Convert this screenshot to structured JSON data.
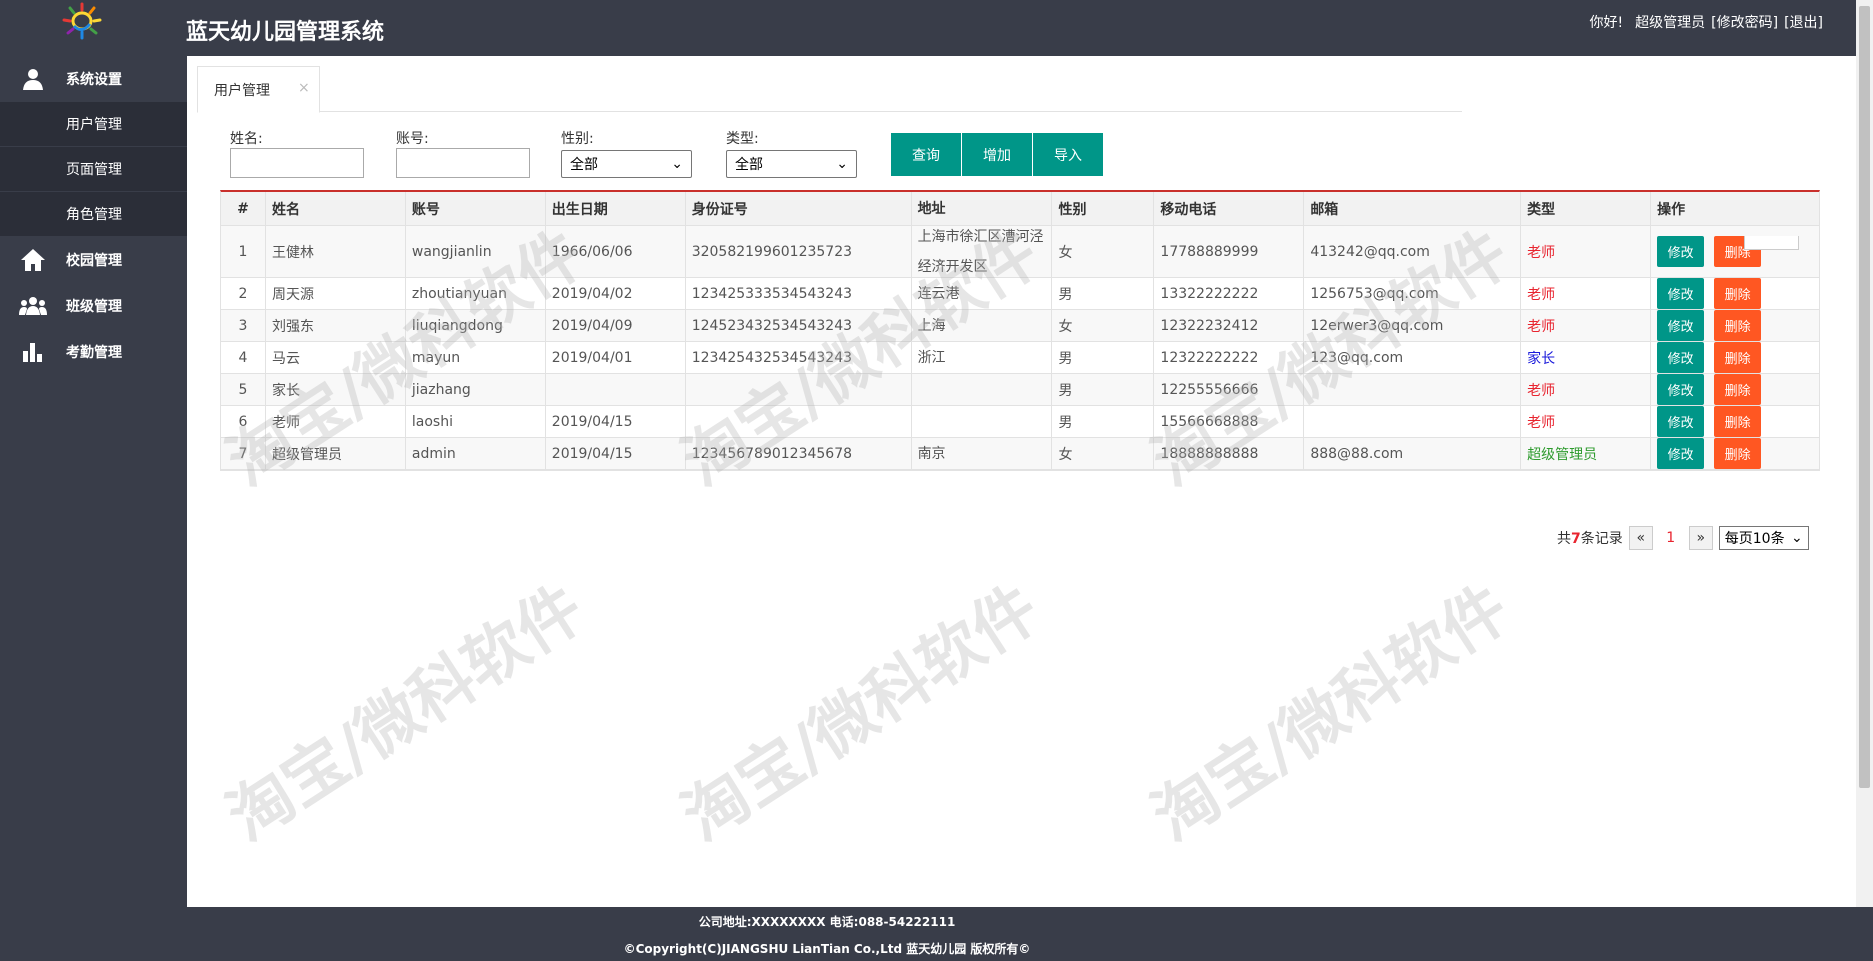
{
  "header": {
    "title": "蓝天幼儿园管理系统",
    "greeting": "你好!",
    "user_name": "超级管理员",
    "change_password": "[修改密码]",
    "logout": "[退出]"
  },
  "sidebar": {
    "groups": [
      {
        "label": "系统设置",
        "icon": "user-icon"
      },
      {
        "label": "校园管理",
        "icon": "home-icon"
      },
      {
        "label": "班级管理",
        "icon": "users-icon"
      },
      {
        "label": "考勤管理",
        "icon": "bar-chart-icon"
      }
    ],
    "sub_items": [
      "用户管理",
      "页面管理",
      "角色管理"
    ]
  },
  "tab": {
    "label": "用户管理",
    "close": "×"
  },
  "search": {
    "name_label": "姓名:",
    "account_label": "账号:",
    "gender_label": "性别:",
    "gender_value": "全部",
    "type_label": "类型:",
    "type_value": "全部",
    "buttons": {
      "query": "查询",
      "add": "增加",
      "import": "导入"
    }
  },
  "table": {
    "columns": [
      "#",
      "姓名",
      "账号",
      "出生日期",
      "身份证号",
      "地址",
      "性别",
      "移动电话",
      "邮箱",
      "类型",
      "操作"
    ],
    "edit_label": "修改",
    "delete_label": "删除",
    "rows": [
      {
        "no": "1",
        "name": "王健林",
        "account": "wangjianlin",
        "birth": "1966/06/06",
        "id": "320582199601235723",
        "addr": "上海市徐汇区漕河泾经济开发区",
        "gender": "女",
        "phone": "17788889999",
        "email": "413242@qq.com",
        "type": "老师",
        "type_class": "teacher"
      },
      {
        "no": "2",
        "name": "周天源",
        "account": "zhoutianyuan",
        "birth": "2019/04/02",
        "id": "123425333534543243",
        "addr": "连云港",
        "gender": "男",
        "phone": "13322222222",
        "email": "1256753@qq.com",
        "type": "老师",
        "type_class": "teacher"
      },
      {
        "no": "3",
        "name": "刘强东",
        "account": "liuqiangdong",
        "birth": "2019/04/09",
        "id": "124523432534543243",
        "addr": "上海",
        "gender": "女",
        "phone": "12322232412",
        "email": "12erwer3@qq.com",
        "type": "老师",
        "type_class": "teacher"
      },
      {
        "no": "4",
        "name": "马云",
        "account": "mayun",
        "birth": "2019/04/01",
        "id": "123425432534543243",
        "addr": "浙江",
        "gender": "男",
        "phone": "12322222222",
        "email": "123@qq.com",
        "type": "家长",
        "type_class": "parent"
      },
      {
        "no": "5",
        "name": "家长",
        "account": "jiazhang",
        "birth": "",
        "id": "",
        "addr": "",
        "gender": "男",
        "phone": "12255556666",
        "email": "",
        "type": "老师",
        "type_class": "teacher"
      },
      {
        "no": "6",
        "name": "老师",
        "account": "laoshi",
        "birth": "2019/04/15",
        "id": "",
        "addr": "",
        "gender": "男",
        "phone": "15566668888",
        "email": "",
        "type": "老师",
        "type_class": "teacher"
      },
      {
        "no": "7",
        "name": "超级管理员",
        "account": "admin",
        "birth": "2019/04/15",
        "id": "123456789012345678",
        "addr": "南京",
        "gender": "女",
        "phone": "18888888888",
        "email": "888@88.com",
        "type": "超级管理员",
        "type_class": "admin"
      }
    ]
  },
  "pager": {
    "total_prefix": "共",
    "total": "7",
    "total_suffix": "条记录",
    "prev": "«",
    "current": "1",
    "next": "»",
    "page_size": "每页10条"
  },
  "footer": {
    "line1": "公司地址:XXXXXXXX 电话:088-54222111",
    "line2": "©Copyright(C)JIANGSHU LianTian Co.,Ltd 蓝天幼儿园 版权所有©"
  },
  "watermark": "淘宝/微科软件",
  "colors": {
    "sidebar": "#393d49",
    "primary": "#009688",
    "danger": "#ff5722",
    "teacher": "#e8242f",
    "parent": "#1a1adb",
    "admin": "#2e9b2e"
  }
}
